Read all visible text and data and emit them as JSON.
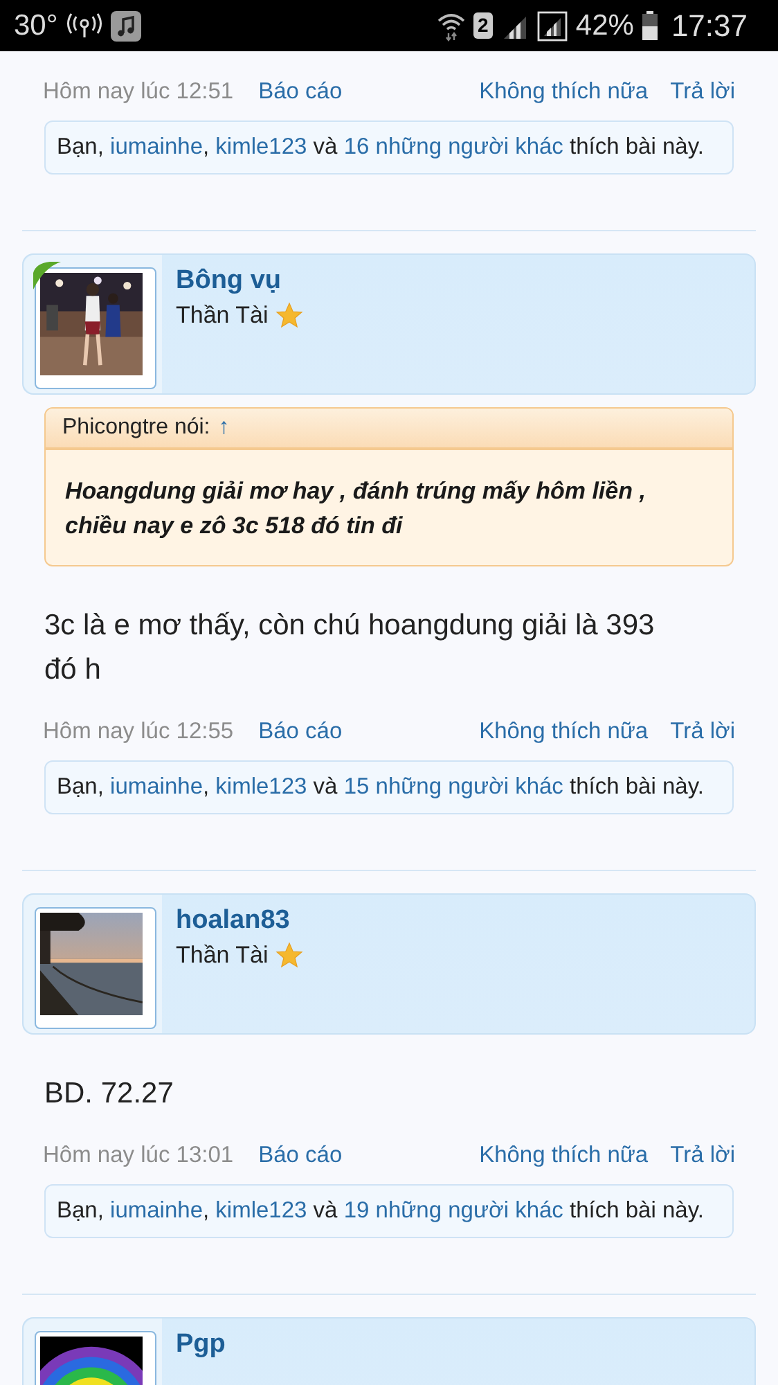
{
  "status_bar": {
    "temperature": "30°",
    "sim": "2",
    "battery": "42%",
    "time": "17:37"
  },
  "posts": [
    {
      "meta": {
        "time": "Hôm nay lúc 12:51",
        "report": "Báo cáo",
        "unlike": "Không thích nữa",
        "reply": "Trả lời"
      },
      "likes": [
        {
          "text": "Bạn, ",
          "kind": "plain"
        },
        {
          "text": "iumainhe",
          "kind": "link"
        },
        {
          "text": ", ",
          "kind": "plain"
        },
        {
          "text": "kimle123",
          "kind": "link"
        },
        {
          "text": " và ",
          "kind": "plain"
        },
        {
          "text": "16 những người khác",
          "kind": "link"
        },
        {
          "text": " thích bài này.",
          "kind": "plain"
        }
      ]
    },
    {
      "author": {
        "name": "Bông vụ",
        "title": "Thần Tài",
        "ribbon": true
      },
      "quote": {
        "author": "Phicongtre nói:",
        "arrow": "↑",
        "text": "Hoangdung giải mơ hay , đánh trúng mấy hôm liền , chiều nay e zô 3c 518 đó tin đi"
      },
      "body": "3c là e mơ thấy, còn chú hoangdung giải là 393 đó h",
      "meta": {
        "time": "Hôm nay lúc 12:55",
        "report": "Báo cáo",
        "unlike": "Không thích nữa",
        "reply": "Trả lời"
      },
      "likes": [
        {
          "text": "Bạn, ",
          "kind": "plain"
        },
        {
          "text": "iumainhe",
          "kind": "link"
        },
        {
          "text": ", ",
          "kind": "plain"
        },
        {
          "text": "kimle123",
          "kind": "link"
        },
        {
          "text": " và ",
          "kind": "plain"
        },
        {
          "text": "15 những người khác",
          "kind": "link"
        },
        {
          "text": " thích bài này.",
          "kind": "plain"
        }
      ]
    },
    {
      "author": {
        "name": "hoalan83",
        "title": "Thần Tài",
        "ribbon": false
      },
      "body": "BD. 72.27",
      "meta": {
        "time": "Hôm nay lúc 13:01",
        "report": "Báo cáo",
        "unlike": "Không thích nữa",
        "reply": "Trả lời"
      },
      "likes": [
        {
          "text": "Bạn, ",
          "kind": "plain"
        },
        {
          "text": "iumainhe",
          "kind": "link"
        },
        {
          "text": ", ",
          "kind": "plain"
        },
        {
          "text": "kimle123",
          "kind": "link"
        },
        {
          "text": " và ",
          "kind": "plain"
        },
        {
          "text": "19 những người khác",
          "kind": "link"
        },
        {
          "text": " thích bài này.",
          "kind": "plain"
        }
      ]
    },
    {
      "author": {
        "name": "Pgp",
        "ribbon": false
      }
    }
  ]
}
